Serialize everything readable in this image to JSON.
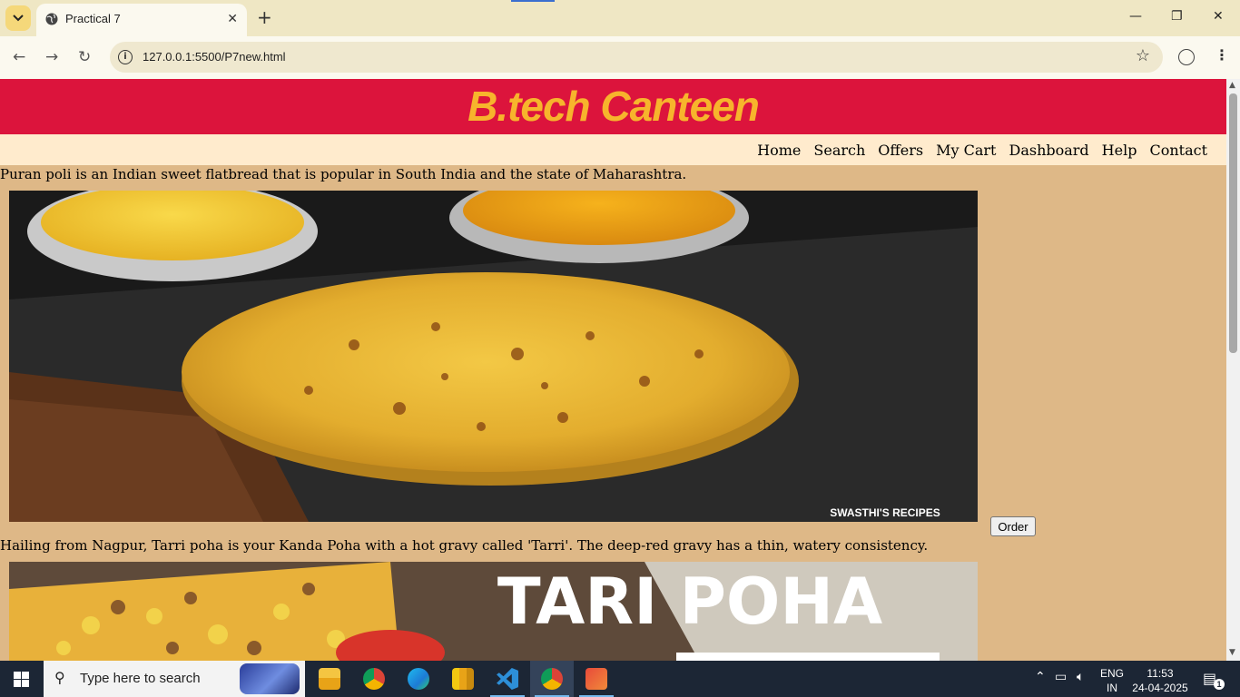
{
  "browser": {
    "tab_title": "Practical 7",
    "url": "127.0.0.1:5500/P7new.html"
  },
  "site": {
    "title": "B.tech Canteen",
    "nav": [
      "Home",
      "Search",
      "Offers",
      "My Cart",
      "Dashboard",
      "Help",
      "Contact"
    ]
  },
  "items": [
    {
      "description": "Puran poli is an Indian sweet flatbread that is popular in South India and the state of Maharashtra.",
      "image_caption": "SWASTHI'S RECIPES",
      "order_label": "Order"
    },
    {
      "description": "Hailing from Nagpur, Tarri poha is your Kanda Poha with a hot gravy called 'Tarri'. The deep-red gravy has a thin, watery consistency.",
      "image_caption": "TARI POHA"
    }
  ],
  "taskbar": {
    "search_placeholder": "Type here to search",
    "lang_line1": "ENG",
    "lang_line2": "IN",
    "time": "11:53",
    "date": "24-04-2025",
    "notification_count": "1"
  },
  "colors": {
    "header_bg": "#dc143c",
    "title_color": "#f7b42c",
    "nav_bg": "#ffebcd",
    "page_bg": "#deb887"
  }
}
